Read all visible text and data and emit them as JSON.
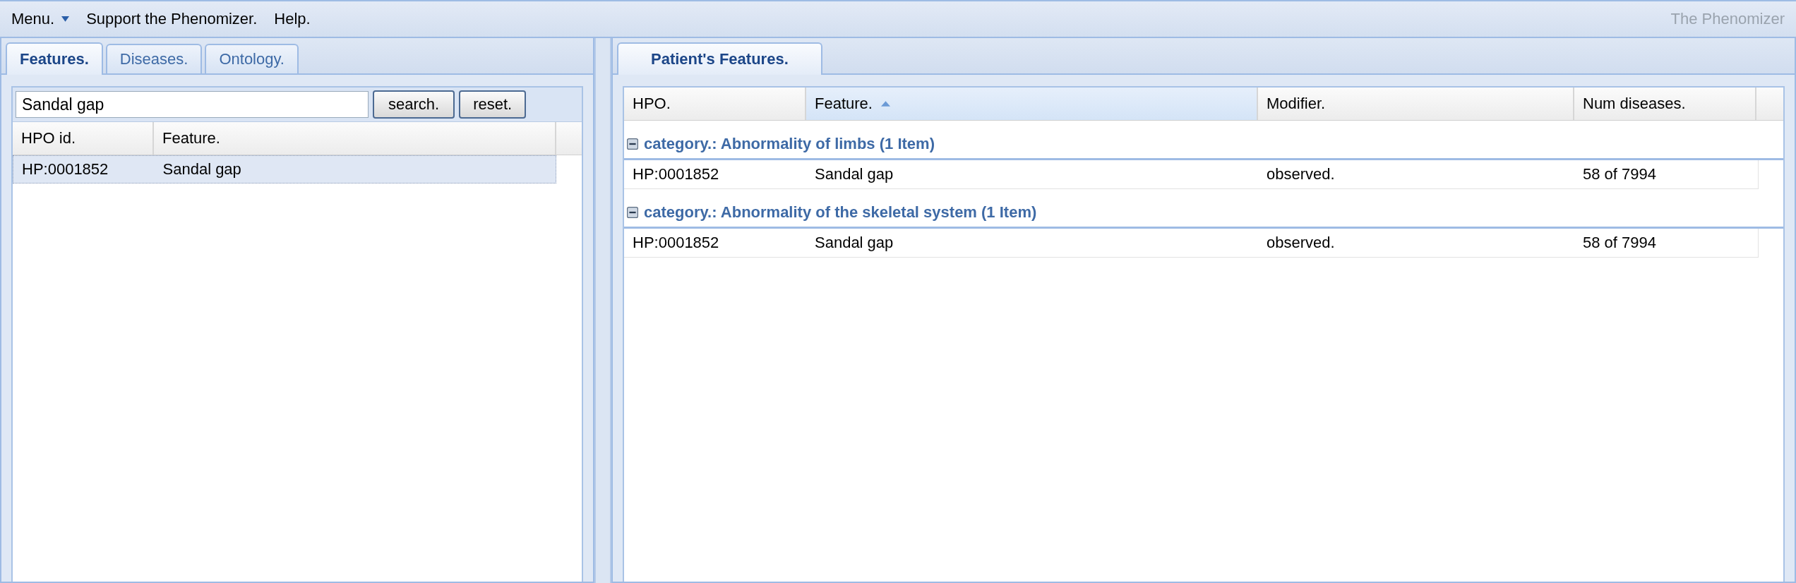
{
  "menu_bar": {
    "items": [
      {
        "label": "Menu.",
        "has_dropdown": true
      },
      {
        "label": "Support the Phenomizer.",
        "has_dropdown": false
      },
      {
        "label": "Help.",
        "has_dropdown": false
      }
    ],
    "app_title": "The Phenomizer"
  },
  "left_panel": {
    "tabs": [
      {
        "label": "Features.",
        "selected": true
      },
      {
        "label": "Diseases.",
        "selected": false
      },
      {
        "label": "Ontology.",
        "selected": false
      }
    ],
    "search": {
      "value": "Sandal gap",
      "buttons": [
        "search.",
        "reset."
      ]
    },
    "table": {
      "columns": [
        "HPO id.",
        "Feature."
      ],
      "rows": [
        {
          "cells": [
            "HP:0001852",
            "Sandal gap"
          ],
          "selected": true
        }
      ]
    }
  },
  "right_panel": {
    "tabs": [
      {
        "label": "Patient's Features.",
        "selected": true
      }
    ],
    "table": {
      "columns": [
        {
          "label": "HPO.",
          "sorted": false
        },
        {
          "label": "Feature.",
          "sorted": true
        },
        {
          "label": "Modifier.",
          "sorted": false
        },
        {
          "label": "Num diseases.",
          "sorted": false
        }
      ],
      "groups": [
        {
          "title": "category.: Abnormality of limbs (1 Item)",
          "expanded": true,
          "rows": [
            [
              "HP:0001852",
              "Sandal gap",
              "observed.",
              "58 of 7994"
            ]
          ]
        },
        {
          "title": "category.: Abnormality of the skeletal system (1 Item)",
          "expanded": true,
          "rows": [
            [
              "HP:0001852",
              "Sandal gap",
              "observed.",
              "58 of 7994"
            ]
          ]
        }
      ]
    }
  }
}
